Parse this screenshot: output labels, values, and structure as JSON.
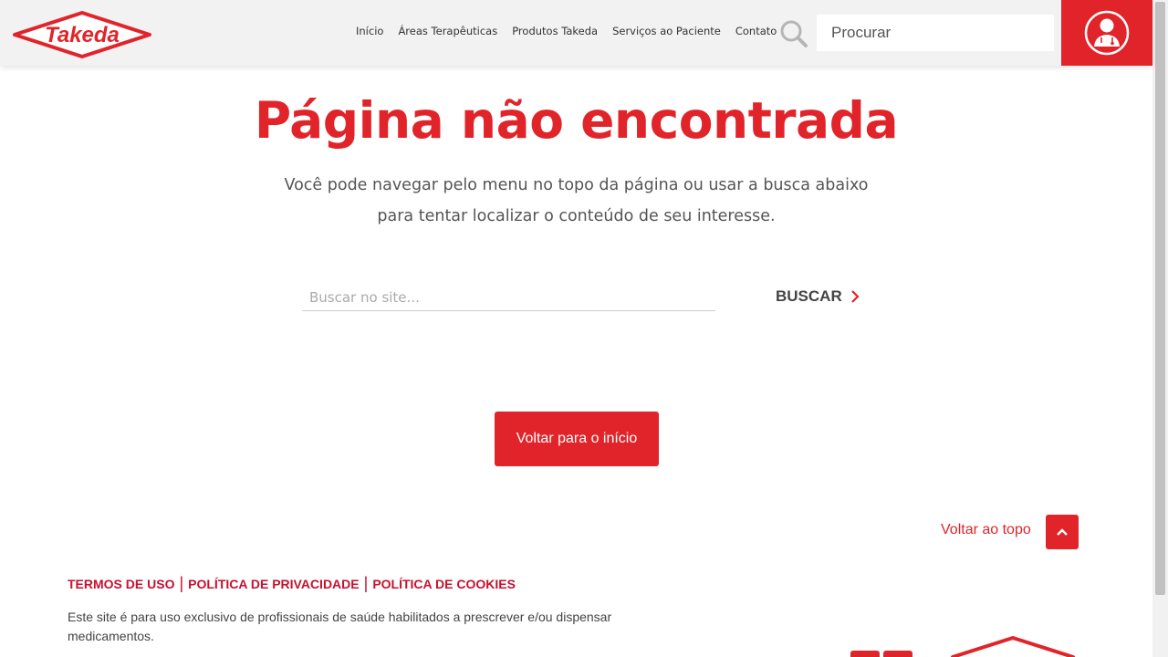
{
  "header": {
    "logo_text": "Takeda",
    "nav": [
      "Início",
      "Áreas Terapêuticas",
      "Produtos Takeda",
      "Serviços ao Paciente",
      "Contato"
    ],
    "search_placeholder": "Procurar",
    "icons": {
      "search": "search-icon",
      "profile": "doctor-profile-icon"
    }
  },
  "main": {
    "title": "Página não encontrada",
    "subtitle": "Você pode navegar pelo menu no topo da página ou usar a busca abaixo para tentar localizar o conteúdo de seu interesse.",
    "search_placeholder": "Buscar no site...",
    "search_button": "BUSCAR",
    "home_button": "Voltar para o início"
  },
  "footer": {
    "back_to_top": "Voltar ao topo",
    "links": [
      "TERMOS DE USO",
      "POLÍTICA DE PRIVACIDADE",
      "POLÍTICA DE COOKIES"
    ],
    "disclaimer": "Este site é para uso exclusivo de profissionais de saúde habilitados a prescrever e/ou dispensar medicamentos."
  },
  "colors": {
    "brand_red": "#e1242a",
    "link_red": "#c8102e",
    "header_bg": "#f2f2f2"
  }
}
